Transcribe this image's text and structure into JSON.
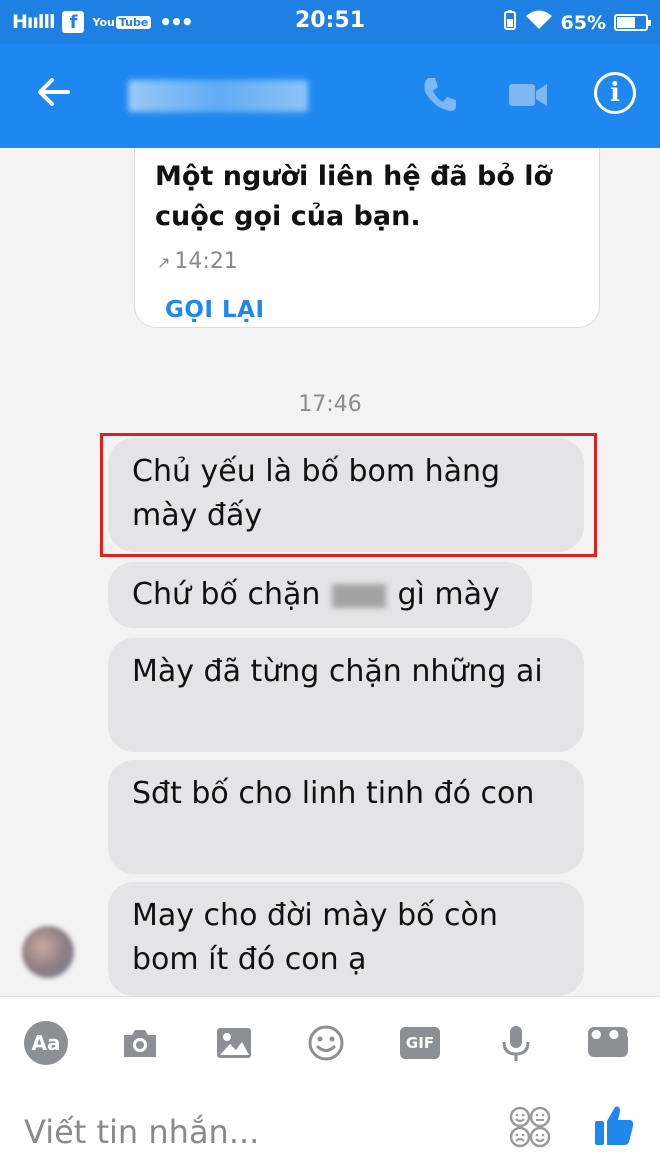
{
  "status_bar": {
    "signal": "H",
    "time": "20:51",
    "battery": "65%",
    "battery_level": 0.65
  },
  "header": {
    "icons": [
      "back-arrow-icon",
      "phone-icon",
      "video-camera-icon",
      "info-icon"
    ]
  },
  "call_card": {
    "message": "Một người liên hệ đã bỏ lỡ cuộc gọi của bạn.",
    "time": "14:21",
    "call_back_label": "GỌI LẠI"
  },
  "conversation": {
    "timestamp": "17:46",
    "messages": [
      {
        "text": "Chủ yếu là bố bom hàng mày đấy",
        "highlighted": true
      },
      {
        "text_before": "Chứ bố chặn",
        "text_after": "gì mày"
      },
      {
        "text": "Mày đã từng chặn những ai"
      },
      {
        "text": "Sđt bố cho linh tinh đó con"
      },
      {
        "text": "May cho đời mày bố còn bom ít đó con ạ"
      }
    ]
  },
  "composer": {
    "aa_label": "Aa",
    "gif_label": "GIF",
    "placeholder": "Viết tin nhắn...",
    "icons": [
      "camera-icon",
      "image-icon",
      "emoji-icon",
      "microphone-icon",
      "more-icon",
      "sticker-icon",
      "thumbs-up-icon"
    ]
  },
  "colors": {
    "header_blue": "#1e88f0",
    "status_blue": "#1f80e4",
    "bubble_gray": "#e4e4e6",
    "highlight_red": "#e01f1f",
    "link_blue": "#1e88f0"
  }
}
